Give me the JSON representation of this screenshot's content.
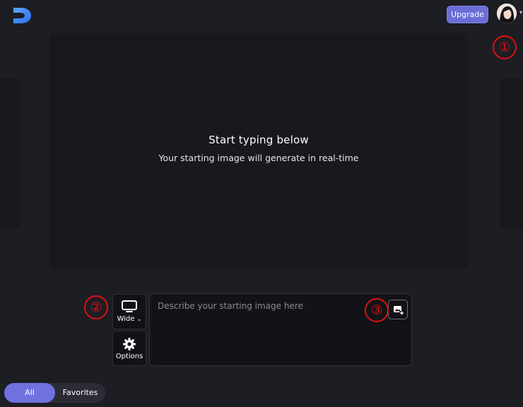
{
  "header": {
    "upgrade_label": "Upgrade",
    "accent_color": "#6a6ed6"
  },
  "canvas": {
    "title": "Start typing below",
    "subtitle": "Your starting image will generate in real-time"
  },
  "controls": {
    "aspect_label": "Wide",
    "options_label": "Options"
  },
  "prompt": {
    "placeholder": "Describe your starting image here",
    "value": ""
  },
  "tabs": [
    {
      "label": "All",
      "active": true
    },
    {
      "label": "Favorites",
      "active": false
    }
  ],
  "annotations": [
    "①",
    "②",
    "③"
  ]
}
